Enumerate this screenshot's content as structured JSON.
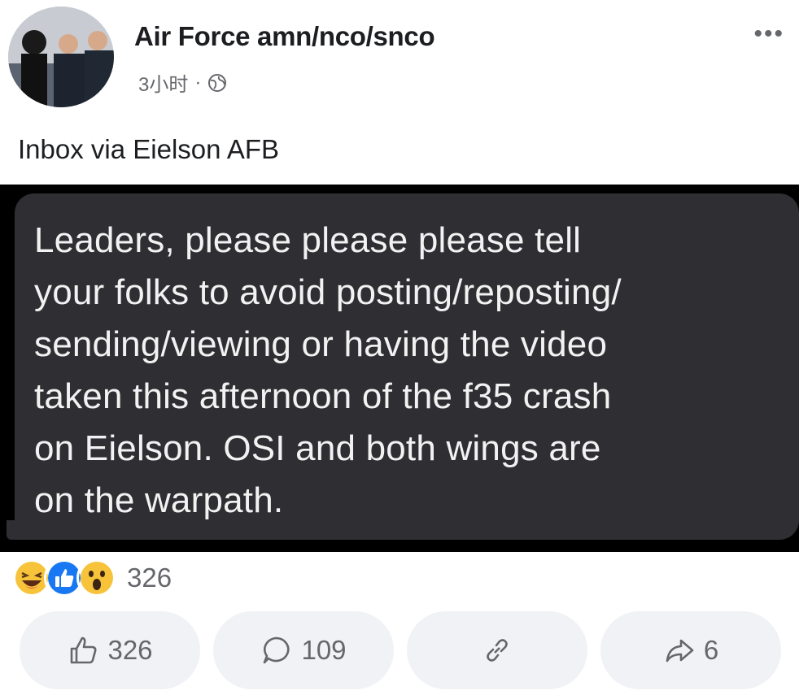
{
  "post": {
    "author": "Air Force amn/nco/snco",
    "time": "3小时",
    "separator": "·",
    "caption": "Inbox via Eielson AFB",
    "message": "Leaders, please please please tell\nyour folks to avoid posting/reposting/\nsending/viewing or having the video\ntaken this afternoon of the f35 crash\non Eielson. OSI and both wings are\non the warpath."
  },
  "reactions": {
    "icons": [
      "haha-icon",
      "like-icon",
      "wow-icon"
    ],
    "count": "326"
  },
  "actions": {
    "like_count": "326",
    "comment_count": "109",
    "share_count": "6"
  },
  "colors": {
    "bubble": "#2f2f33",
    "like_blue": "#1877f2",
    "emoji_yellow": "#f7c33b"
  }
}
